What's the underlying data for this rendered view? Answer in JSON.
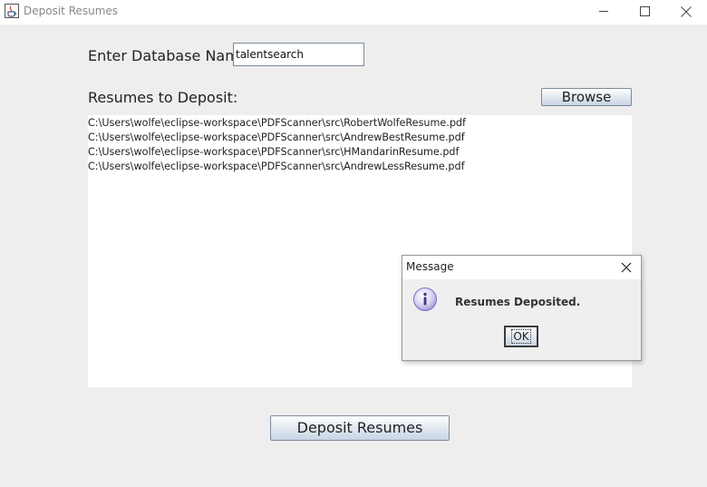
{
  "window": {
    "title": "Deposit Resumes",
    "icons": [
      "java-cup-icon",
      "minimize-icon",
      "maximize-icon",
      "close-icon"
    ]
  },
  "form": {
    "db_label": "Enter Database Name:",
    "db_value": "talentsearch",
    "resumes_label": "Resumes to Deposit:",
    "browse_label": "Browse",
    "files": [
      "C:\\Users\\wolfe\\eclipse-workspace\\PDFScanner\\src\\RobertWolfeResume.pdf",
      "C:\\Users\\wolfe\\eclipse-workspace\\PDFScanner\\src\\AndrewBestResume.pdf",
      "C:\\Users\\wolfe\\eclipse-workspace\\PDFScanner\\src\\HMandarinResume.pdf",
      "C:\\Users\\wolfe\\eclipse-workspace\\PDFScanner\\src\\AndrewLessResume.pdf"
    ],
    "deposit_label": "Deposit Resumes"
  },
  "dialog": {
    "title": "Message",
    "message": "Resumes Deposited.",
    "ok_label": "OK",
    "icon": "info-icon"
  },
  "colors": {
    "window_bg": "#eeeeee",
    "info_icon": "#9c8fd6"
  }
}
